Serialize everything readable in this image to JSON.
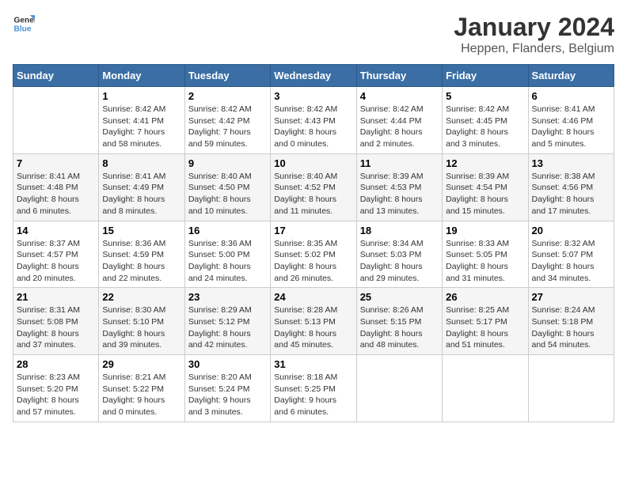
{
  "header": {
    "logo_line1": "General",
    "logo_line2": "Blue",
    "title": "January 2024",
    "subtitle": "Heppen, Flanders, Belgium"
  },
  "weekdays": [
    "Sunday",
    "Monday",
    "Tuesday",
    "Wednesday",
    "Thursday",
    "Friday",
    "Saturday"
  ],
  "weeks": [
    [
      {
        "day": "",
        "detail": ""
      },
      {
        "day": "1",
        "detail": "Sunrise: 8:42 AM\nSunset: 4:41 PM\nDaylight: 7 hours\nand 58 minutes."
      },
      {
        "day": "2",
        "detail": "Sunrise: 8:42 AM\nSunset: 4:42 PM\nDaylight: 7 hours\nand 59 minutes."
      },
      {
        "day": "3",
        "detail": "Sunrise: 8:42 AM\nSunset: 4:43 PM\nDaylight: 8 hours\nand 0 minutes."
      },
      {
        "day": "4",
        "detail": "Sunrise: 8:42 AM\nSunset: 4:44 PM\nDaylight: 8 hours\nand 2 minutes."
      },
      {
        "day": "5",
        "detail": "Sunrise: 8:42 AM\nSunset: 4:45 PM\nDaylight: 8 hours\nand 3 minutes."
      },
      {
        "day": "6",
        "detail": "Sunrise: 8:41 AM\nSunset: 4:46 PM\nDaylight: 8 hours\nand 5 minutes."
      }
    ],
    [
      {
        "day": "7",
        "detail": "Sunrise: 8:41 AM\nSunset: 4:48 PM\nDaylight: 8 hours\nand 6 minutes."
      },
      {
        "day": "8",
        "detail": "Sunrise: 8:41 AM\nSunset: 4:49 PM\nDaylight: 8 hours\nand 8 minutes."
      },
      {
        "day": "9",
        "detail": "Sunrise: 8:40 AM\nSunset: 4:50 PM\nDaylight: 8 hours\nand 10 minutes."
      },
      {
        "day": "10",
        "detail": "Sunrise: 8:40 AM\nSunset: 4:52 PM\nDaylight: 8 hours\nand 11 minutes."
      },
      {
        "day": "11",
        "detail": "Sunrise: 8:39 AM\nSunset: 4:53 PM\nDaylight: 8 hours\nand 13 minutes."
      },
      {
        "day": "12",
        "detail": "Sunrise: 8:39 AM\nSunset: 4:54 PM\nDaylight: 8 hours\nand 15 minutes."
      },
      {
        "day": "13",
        "detail": "Sunrise: 8:38 AM\nSunset: 4:56 PM\nDaylight: 8 hours\nand 17 minutes."
      }
    ],
    [
      {
        "day": "14",
        "detail": "Sunrise: 8:37 AM\nSunset: 4:57 PM\nDaylight: 8 hours\nand 20 minutes."
      },
      {
        "day": "15",
        "detail": "Sunrise: 8:36 AM\nSunset: 4:59 PM\nDaylight: 8 hours\nand 22 minutes."
      },
      {
        "day": "16",
        "detail": "Sunrise: 8:36 AM\nSunset: 5:00 PM\nDaylight: 8 hours\nand 24 minutes."
      },
      {
        "day": "17",
        "detail": "Sunrise: 8:35 AM\nSunset: 5:02 PM\nDaylight: 8 hours\nand 26 minutes."
      },
      {
        "day": "18",
        "detail": "Sunrise: 8:34 AM\nSunset: 5:03 PM\nDaylight: 8 hours\nand 29 minutes."
      },
      {
        "day": "19",
        "detail": "Sunrise: 8:33 AM\nSunset: 5:05 PM\nDaylight: 8 hours\nand 31 minutes."
      },
      {
        "day": "20",
        "detail": "Sunrise: 8:32 AM\nSunset: 5:07 PM\nDaylight: 8 hours\nand 34 minutes."
      }
    ],
    [
      {
        "day": "21",
        "detail": "Sunrise: 8:31 AM\nSunset: 5:08 PM\nDaylight: 8 hours\nand 37 minutes."
      },
      {
        "day": "22",
        "detail": "Sunrise: 8:30 AM\nSunset: 5:10 PM\nDaylight: 8 hours\nand 39 minutes."
      },
      {
        "day": "23",
        "detail": "Sunrise: 8:29 AM\nSunset: 5:12 PM\nDaylight: 8 hours\nand 42 minutes."
      },
      {
        "day": "24",
        "detail": "Sunrise: 8:28 AM\nSunset: 5:13 PM\nDaylight: 8 hours\nand 45 minutes."
      },
      {
        "day": "25",
        "detail": "Sunrise: 8:26 AM\nSunset: 5:15 PM\nDaylight: 8 hours\nand 48 minutes."
      },
      {
        "day": "26",
        "detail": "Sunrise: 8:25 AM\nSunset: 5:17 PM\nDaylight: 8 hours\nand 51 minutes."
      },
      {
        "day": "27",
        "detail": "Sunrise: 8:24 AM\nSunset: 5:18 PM\nDaylight: 8 hours\nand 54 minutes."
      }
    ],
    [
      {
        "day": "28",
        "detail": "Sunrise: 8:23 AM\nSunset: 5:20 PM\nDaylight: 8 hours\nand 57 minutes."
      },
      {
        "day": "29",
        "detail": "Sunrise: 8:21 AM\nSunset: 5:22 PM\nDaylight: 9 hours\nand 0 minutes."
      },
      {
        "day": "30",
        "detail": "Sunrise: 8:20 AM\nSunset: 5:24 PM\nDaylight: 9 hours\nand 3 minutes."
      },
      {
        "day": "31",
        "detail": "Sunrise: 8:18 AM\nSunset: 5:25 PM\nDaylight: 9 hours\nand 6 minutes."
      },
      {
        "day": "",
        "detail": ""
      },
      {
        "day": "",
        "detail": ""
      },
      {
        "day": "",
        "detail": ""
      }
    ]
  ]
}
